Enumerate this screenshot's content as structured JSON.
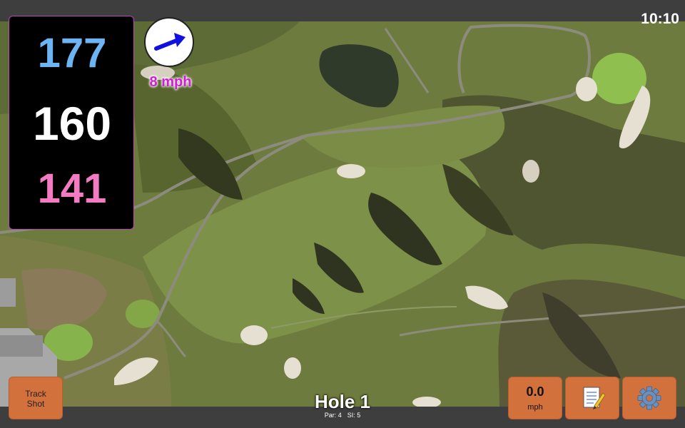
{
  "status": {
    "time": "10:10"
  },
  "distances": {
    "back": "177",
    "middle": "160",
    "front": "141",
    "back_color": "#6db4f2",
    "middle_color": "#ffffff",
    "front_color": "#f37bc2"
  },
  "wind": {
    "speed_label": "8 mph",
    "direction_icon": "arrow-right-icon",
    "arrow_color": "#1010e0"
  },
  "hole": {
    "title": "Hole 1",
    "par": "Par: 4",
    "si": "SI: 5"
  },
  "buttons": {
    "track_line1": "Track",
    "track_line2": "Shot",
    "wind_value": "0.0",
    "wind_unit": "mph",
    "notes_icon": "notepad-icon",
    "settings_icon": "gear-icon",
    "accent_color": "#d2713c"
  },
  "map": {
    "view": "satellite-aerial"
  }
}
